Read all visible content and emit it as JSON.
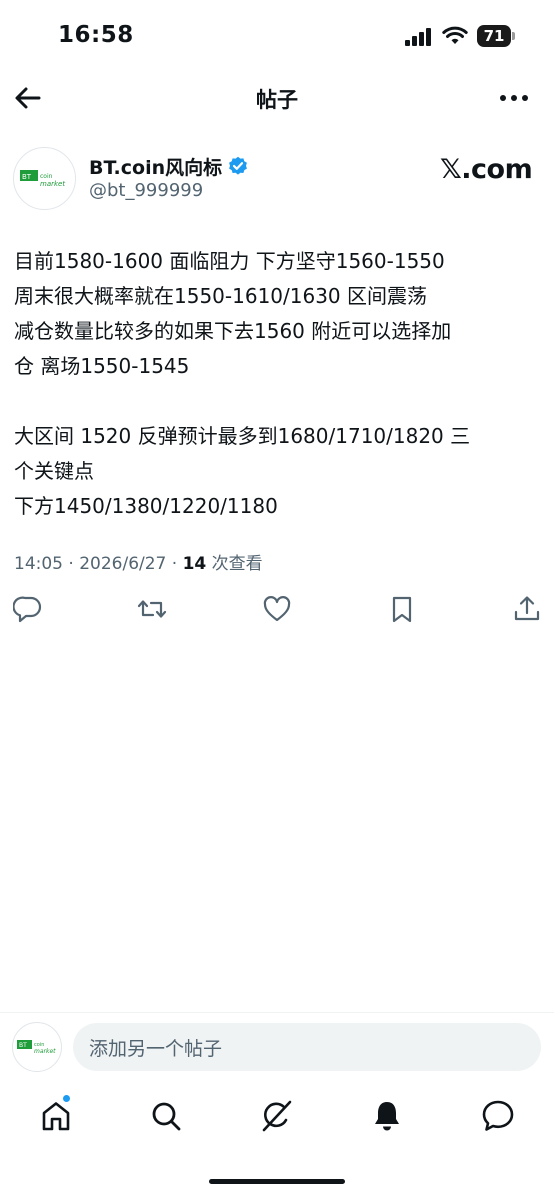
{
  "status_bar": {
    "time": "16:58",
    "battery": "71"
  },
  "header": {
    "title": "帖子"
  },
  "author": {
    "display_name": "BT.coin风向标",
    "handle": "@bt_999999",
    "source_label": "𝕏.com",
    "avatar_text": "market"
  },
  "post": {
    "lines": [
      "目前1580-1600 面临阻力 下方坚守1560-1550",
      "周末很大概率就在1550-1610/1630 区间震荡",
      "减仓数量比较多的如果下去1560 附近可以选择加",
      "仓 离场1550-1545",
      "",
      "大区间 1520 反弹预计最多到1680/1710/1820 三",
      "个关键点",
      "下方1450/1380/1220/1180"
    ]
  },
  "meta": {
    "time": "14:05 · 2026/6/27 · ",
    "views_count": "14",
    "views_label": " 次查看"
  },
  "composer": {
    "placeholder": "添加另一个帖子"
  },
  "colors": {
    "accent": "#1d9bf0",
    "text": "#0f1419",
    "secondary": "#536471"
  },
  "icons": {
    "actions": [
      "reply-icon",
      "repost-icon",
      "like-icon",
      "bookmark-icon",
      "share-icon"
    ],
    "tabs": [
      "home-icon",
      "search-icon",
      "grok-icon",
      "notifications-icon",
      "messages-icon"
    ]
  }
}
